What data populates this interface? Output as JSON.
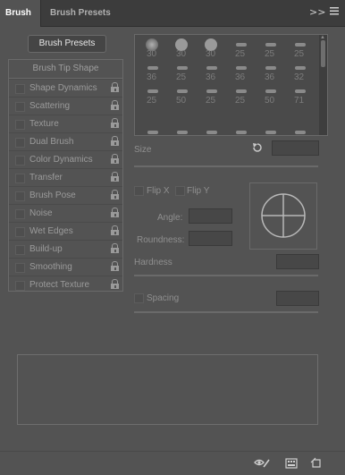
{
  "tabs": [
    {
      "label": "Brush",
      "active": true
    },
    {
      "label": "Brush Presets",
      "active": false
    }
  ],
  "toolbar": {
    "collapse_icon": "double-chevron-right",
    "menu_icon": "hamburger-menu"
  },
  "brush_presets_button": "Brush Presets",
  "options": {
    "header": "Brush Tip Shape",
    "items": [
      {
        "label": "Shape Dynamics",
        "checked": false
      },
      {
        "label": "Scattering",
        "checked": false
      },
      {
        "label": "Texture",
        "checked": false
      },
      {
        "label": "Dual Brush",
        "checked": false
      },
      {
        "label": "Color Dynamics",
        "checked": false
      },
      {
        "label": "Transfer",
        "checked": false
      },
      {
        "label": "Brush Pose",
        "checked": false
      },
      {
        "label": "Noise",
        "checked": false
      },
      {
        "label": "Wet Edges",
        "checked": false
      },
      {
        "label": "Build-up",
        "checked": false
      },
      {
        "label": "Smoothing",
        "checked": false
      },
      {
        "label": "Protect Texture",
        "checked": false
      }
    ]
  },
  "brush_tips": [
    [
      "30",
      "30",
      "30",
      "25",
      "25",
      "25"
    ],
    [
      "36",
      "25",
      "36",
      "36",
      "36",
      "32"
    ],
    [
      "25",
      "50",
      "25",
      "25",
      "50",
      "71"
    ]
  ],
  "size": {
    "label": "Size",
    "value": "",
    "reset_icon": "reset-icon"
  },
  "flip_x": {
    "label": "Flip X",
    "checked": false
  },
  "flip_y": {
    "label": "Flip Y",
    "checked": false
  },
  "angle": {
    "label": "Angle:",
    "value": ""
  },
  "roundness": {
    "label": "Roundness:",
    "value": ""
  },
  "hardness": {
    "label": "Hardness",
    "value": ""
  },
  "spacing": {
    "label": "Spacing",
    "value": "",
    "checked": false
  },
  "bottom_icons": [
    "eye-brush-icon",
    "brush-panel-icon",
    "new-preset-icon"
  ]
}
